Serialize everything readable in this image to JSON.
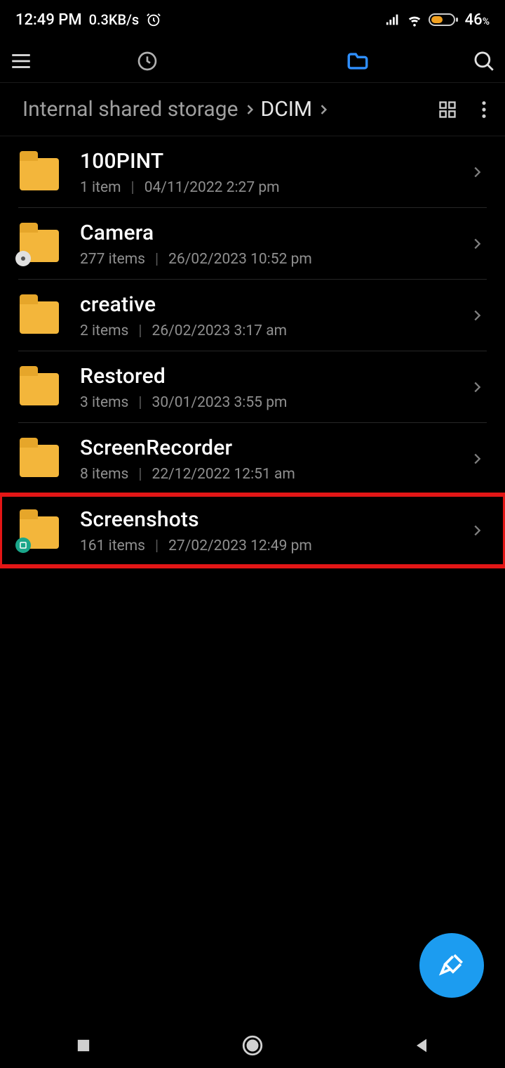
{
  "statusbar": {
    "time": "12:49 PM",
    "net_speed": "0.3KB/s",
    "battery_pct": "46"
  },
  "breadcrumb": {
    "root": "Internal shared storage",
    "current": "DCIM"
  },
  "folders": [
    {
      "name": "100PINT",
      "items": "1 item",
      "date": "04/11/2022 2:27 pm",
      "badge": null,
      "highlight": false
    },
    {
      "name": "Camera",
      "items": "277 items",
      "date": "26/02/2023 10:52 pm",
      "badge": "camera",
      "highlight": false
    },
    {
      "name": "creative",
      "items": "2 items",
      "date": "26/02/2023 3:17 am",
      "badge": null,
      "highlight": false
    },
    {
      "name": "Restored",
      "items": "3 items",
      "date": "30/01/2023 3:55 pm",
      "badge": null,
      "highlight": false
    },
    {
      "name": "ScreenRecorder",
      "items": "8 items",
      "date": "22/12/2022 12:51 am",
      "badge": null,
      "highlight": false
    },
    {
      "name": "Screenshots",
      "items": "161 items",
      "date": "27/02/2023 12:49 pm",
      "badge": "screen",
      "highlight": true
    }
  ]
}
